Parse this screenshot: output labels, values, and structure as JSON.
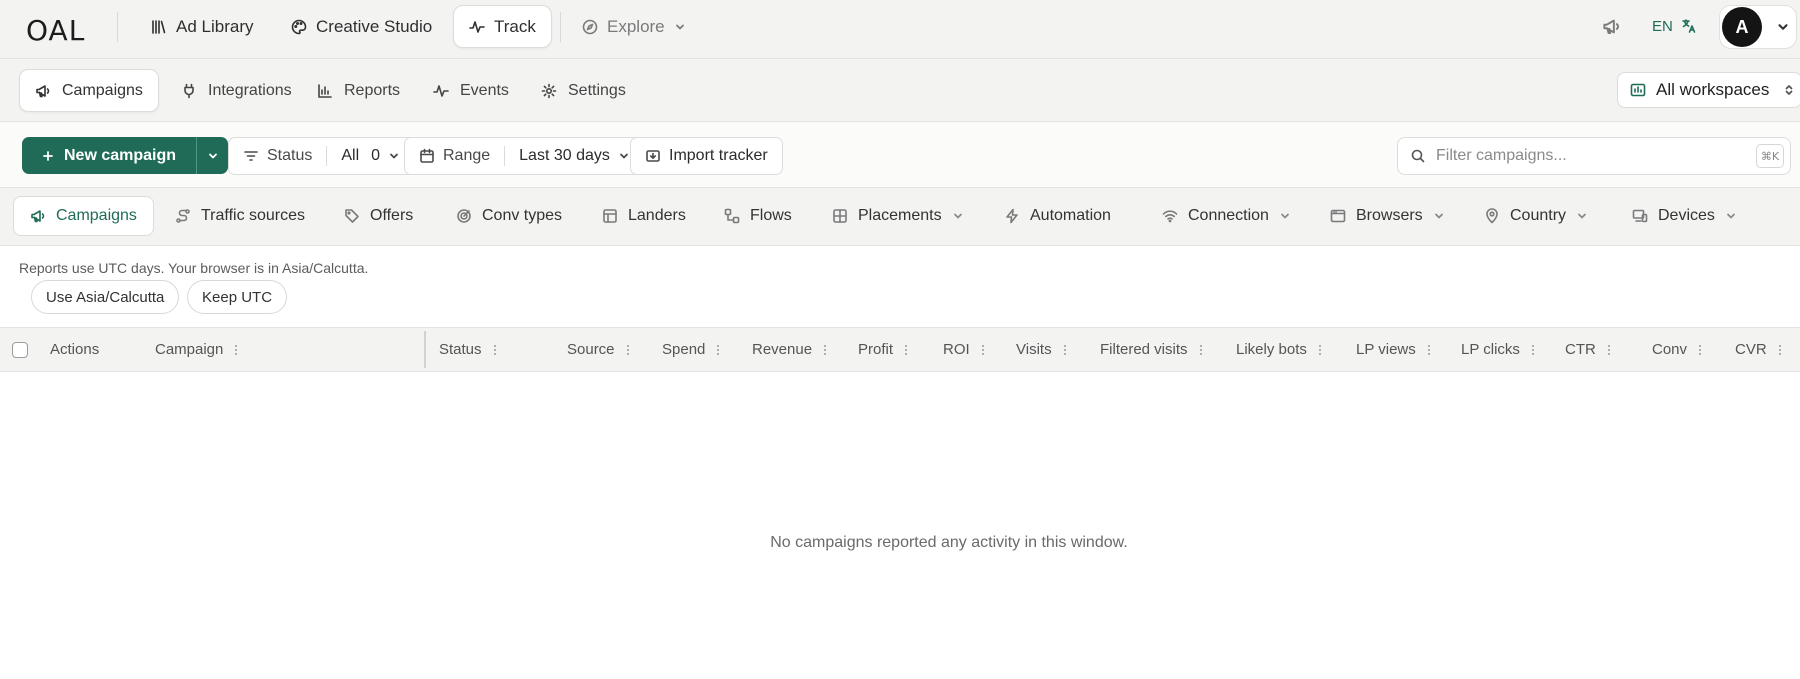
{
  "brand": {
    "logo_text": "OAL",
    "accent": "#1f6b57"
  },
  "top_nav": [
    {
      "label": "Ad Library",
      "icon": "library-icon"
    },
    {
      "label": "Creative Studio",
      "icon": "palette-icon"
    },
    {
      "label": "Track",
      "icon": "activity-icon",
      "active": true
    },
    {
      "label": "Explore",
      "icon": "compass-icon"
    }
  ],
  "top_right": {
    "language": "EN",
    "avatar_initial": "A"
  },
  "section_tabs": [
    {
      "label": "Campaigns",
      "active": true
    },
    {
      "label": "Integrations"
    },
    {
      "label": "Reports"
    },
    {
      "label": "Events"
    },
    {
      "label": "Settings"
    }
  ],
  "workspace": {
    "label": "All workspaces"
  },
  "toolbar": {
    "new_campaign": "New campaign",
    "status_label": "Status",
    "status_value": "All",
    "status_count": "0",
    "range_label": "Range",
    "range_value": "Last 30 days",
    "import_label": "Import tracker",
    "search_placeholder": "Filter campaigns...",
    "search_shortcut": "⌘K"
  },
  "dimension_tabs": [
    {
      "label": "Campaigns",
      "active": true
    },
    {
      "label": "Traffic sources"
    },
    {
      "label": "Offers"
    },
    {
      "label": "Conv types"
    },
    {
      "label": "Landers"
    },
    {
      "label": "Flows"
    },
    {
      "label": "Placements",
      "dropdown": true
    },
    {
      "label": "Automation"
    },
    {
      "label": "Connection",
      "dropdown": true
    },
    {
      "label": "Browsers",
      "dropdown": true
    },
    {
      "label": "Country",
      "dropdown": true
    },
    {
      "label": "Devices",
      "dropdown": true
    }
  ],
  "timezone_notice": {
    "text": "Reports use UTC days. Your browser is in Asia/Calcutta.",
    "use_local": "Use Asia/Calcutta",
    "keep_utc": "Keep UTC"
  },
  "table": {
    "columns": [
      "Actions",
      "Campaign",
      "Status",
      "Source",
      "Spend",
      "Revenue",
      "Profit",
      "ROI",
      "Visits",
      "Filtered visits",
      "Likely bots",
      "LP views",
      "LP clicks",
      "CTR",
      "Conv",
      "CVR"
    ],
    "empty_message": "No campaigns reported any activity in this window."
  }
}
